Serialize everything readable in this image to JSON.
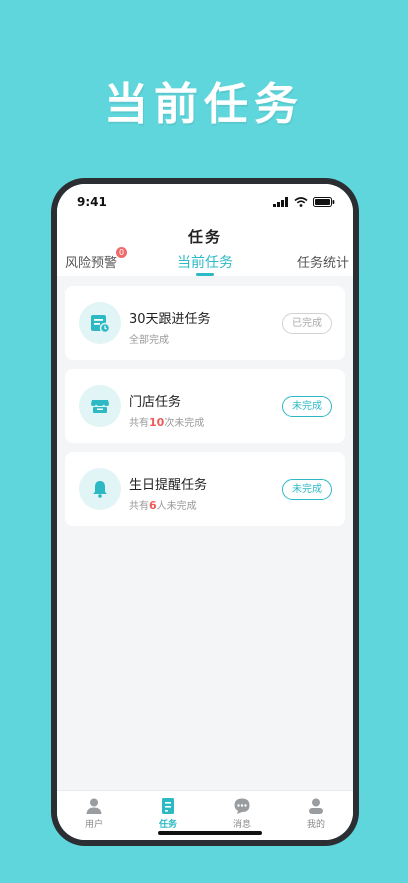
{
  "hero": {
    "title": "当前任务"
  },
  "status_bar": {
    "time": "9:41"
  },
  "nav": {
    "title": "任务"
  },
  "tabs": [
    {
      "label": "风险预警",
      "badge": "0"
    },
    {
      "label": "当前任务"
    },
    {
      "label": "任务统计"
    }
  ],
  "tasks": [
    {
      "title": "30天跟进任务",
      "subtitle": "全部完成",
      "status": "已完成"
    },
    {
      "title": "门店任务",
      "sub_prefix": "共有",
      "sub_count": "10",
      "sub_suffix": "次未完成",
      "status": "未完成"
    },
    {
      "title": "生日提醒任务",
      "sub_prefix": "共有",
      "sub_count": "6",
      "sub_suffix": "人未完成",
      "status": "未完成"
    }
  ],
  "tabbar": [
    {
      "label": "用户",
      "icon": "user-icon"
    },
    {
      "label": "任务",
      "icon": "task-icon"
    },
    {
      "label": "消息",
      "icon": "message-icon"
    },
    {
      "label": "我的",
      "icon": "profile-icon"
    }
  ],
  "colors": {
    "accent": "#2cb9c4",
    "background": "#5fd6db",
    "highlight": "#ef5a5a"
  }
}
